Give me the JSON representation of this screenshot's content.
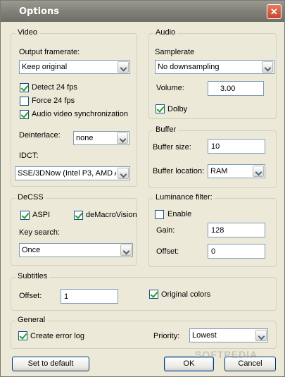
{
  "window": {
    "title": "Options",
    "close_glyph": "✕"
  },
  "video": {
    "legend": "Video",
    "output_framerate_label": "Output framerate:",
    "output_framerate_value": "Keep original",
    "detect_24fps": {
      "label": "Detect 24 fps",
      "checked": true
    },
    "force_24fps": {
      "label": "Force 24 fps",
      "checked": false
    },
    "av_sync": {
      "label": "Audio video synchronization",
      "checked": true
    },
    "deinterlace_label": "Deinterlace:",
    "deinterlace_value": "none",
    "idct_label": "IDCT:",
    "idct_value": "SSE/3DNow (Intel P3, AMD A"
  },
  "audio": {
    "legend": "Audio",
    "samplerate_label": "Samplerate",
    "samplerate_value": "No downsampling",
    "volume_label": "Volume:",
    "volume_value": "3.00",
    "dolby": {
      "label": "Dolby",
      "checked": true
    }
  },
  "buffer": {
    "legend": "Buffer",
    "size_label": "Buffer size:",
    "size_value": "10",
    "location_label": "Buffer location:",
    "location_value": "RAM"
  },
  "decss": {
    "legend": "DeCSS",
    "aspi": {
      "label": "ASPI",
      "checked": true
    },
    "demacrovision": {
      "label": "deMacroVision",
      "checked": true
    },
    "key_search_label": "Key search:",
    "key_search_value": "Once"
  },
  "luminance": {
    "legend": "Luminance filter:",
    "enable": {
      "label": "Enable",
      "checked": false
    },
    "gain_label": "Gain:",
    "gain_value": "128",
    "offset_label": "Offset:",
    "offset_value": "0"
  },
  "subtitles": {
    "legend": "Subtitles",
    "offset_label": "Offset:",
    "offset_value": "1",
    "original_colors": {
      "label": "Original colors",
      "checked": true
    }
  },
  "general": {
    "legend": "General",
    "error_log": {
      "label": "Create error log",
      "checked": true
    },
    "priority_label": "Priority:",
    "priority_value": "Lowest"
  },
  "buttons": {
    "default": "Set to default",
    "ok": "OK",
    "cancel": "Cancel"
  },
  "watermark": "SOFTPEDIA"
}
